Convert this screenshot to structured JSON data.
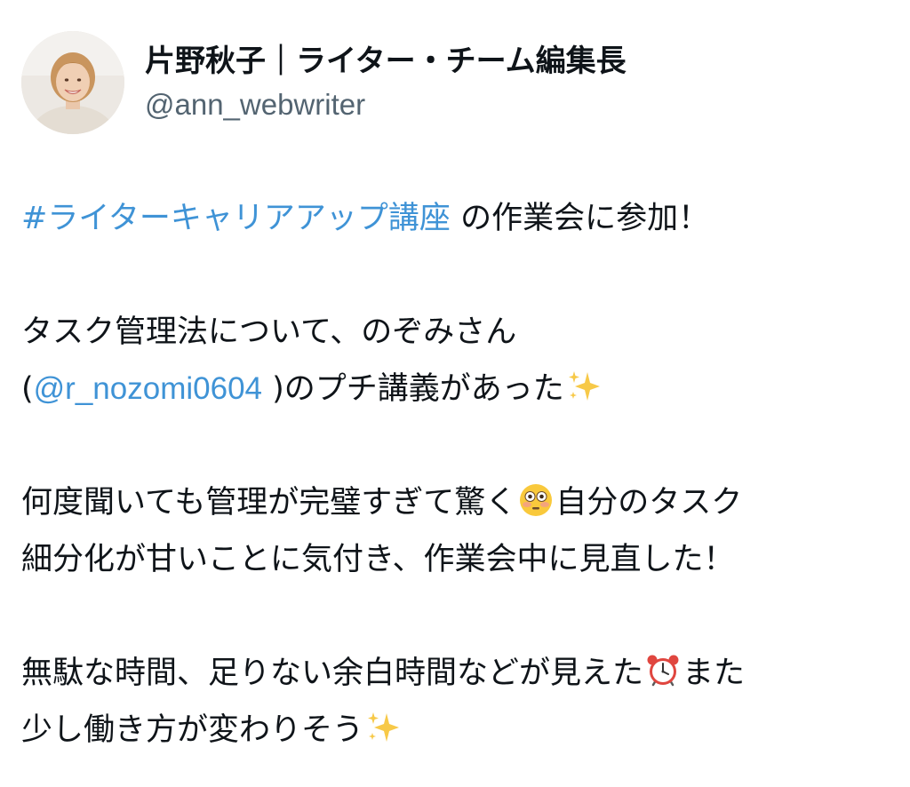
{
  "user": {
    "display_name": "片野秋子｜ライター・チーム編集長",
    "handle": "@ann_webwriter"
  },
  "tweet": {
    "hashtag": "#ライターキャリアアップ講座",
    "line1_rest": " の作業会に参加！",
    "line2": "タスク管理法について、のぞみさん",
    "line3_open": "(",
    "mention": "@r_nozomi0604",
    "line3_rest": " )のプチ講義があった",
    "line4_a": "何度聞いても管理が完璧すぎて驚く",
    "line4_b": "自分のタスク",
    "line5": "細分化が甘いことに気付き、作業会中に見直した！",
    "line6_a": "無駄な時間、足りない余白時間などが見えた",
    "line6_b": "また",
    "line7": "少し働き方が変わりそう"
  },
  "icons": {
    "sparkles": "sparkles-emoji",
    "flushed": "flushed-face-emoji",
    "alarm": "alarm-clock-emoji"
  },
  "colors": {
    "link": "#3f93d6",
    "handle": "#536471",
    "text": "#0f1419"
  }
}
